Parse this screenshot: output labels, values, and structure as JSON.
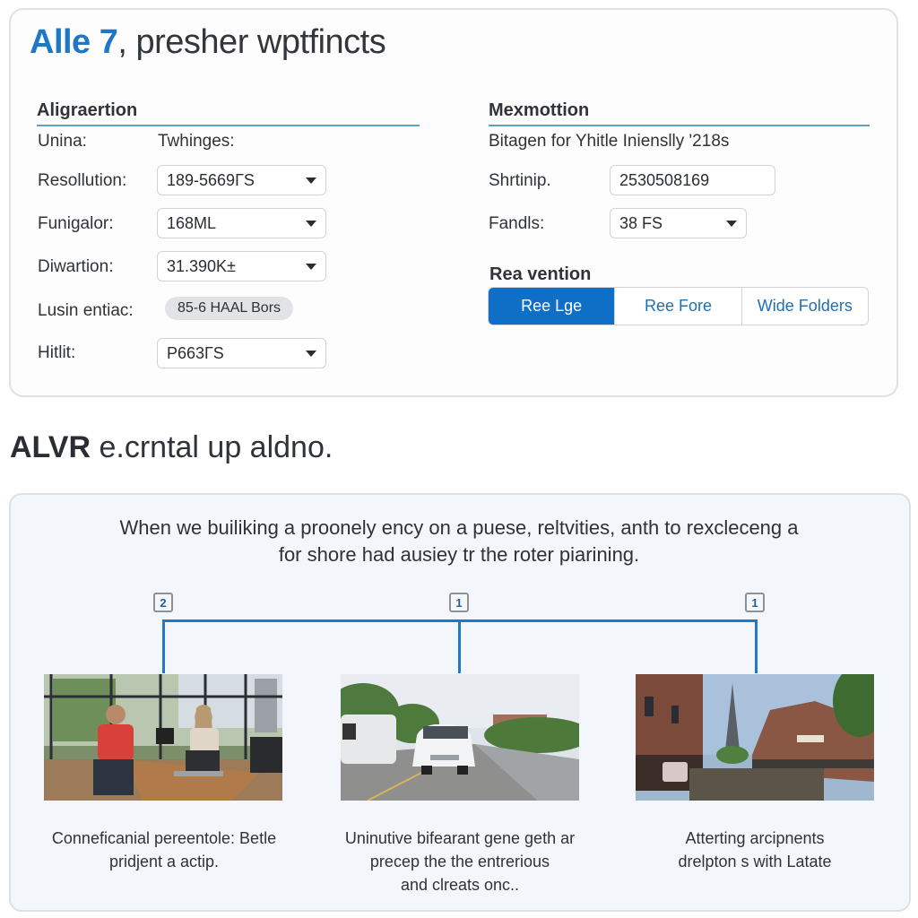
{
  "header": {
    "brand": "Alle 7",
    "title_rest": ", presher wptfincts"
  },
  "left_section": {
    "heading": "Aligraertion",
    "column_label_1": "Unina:",
    "column_label_2": "Twhinges:",
    "fields": [
      {
        "label": "Resollution:",
        "value": "189-5669ГS",
        "type": "select"
      },
      {
        "label": "Funigalor:",
        "value": "168ML",
        "type": "select"
      },
      {
        "label": "Diwartion:",
        "value": "31.390K±",
        "type": "select"
      },
      {
        "label": "Lusin entiac:",
        "value": "85-6 HAAL Bors",
        "type": "pill"
      },
      {
        "label": "Hitlit:",
        "value": "P663ГS",
        "type": "select"
      }
    ]
  },
  "right_section": {
    "heading": "Mexmottion",
    "subtitle": "Bitagen for Yhitle Inienslly '218s",
    "fields": [
      {
        "label": "Shrtinip.",
        "value": "2530508169",
        "type": "input"
      },
      {
        "label": "Fandls:",
        "value": "38 FS",
        "type": "select"
      }
    ],
    "segment_heading": "Rea vention",
    "segments": [
      {
        "label": "Ree Lge",
        "active": true
      },
      {
        "label": "Ree Fore",
        "active": false
      },
      {
        "label": "Wide Folders",
        "active": false
      }
    ]
  },
  "section2": {
    "title_bold": "ALVR",
    "title_rest": " e.crntal up aldno."
  },
  "info": {
    "intro_line1": "When we builiking a proonely ency on a puese, reltvities, anth to rexcleceng a",
    "intro_line2": "for shore had ausiey tr the roter piarining.",
    "steps": [
      {
        "badge": "2",
        "image": "office-meeting-photo",
        "caption_lines": [
          "Conneficanial pereentole: Betle",
          "pridjent a actip."
        ]
      },
      {
        "badge": "1",
        "image": "road-car-photo",
        "caption_lines": [
          "Uninutive bifearant gene geth ar",
          "precep the the entrerious",
          "and clreats onc.."
        ]
      },
      {
        "badge": "1",
        "image": "eiffel-canal-photo",
        "caption_lines": [
          "Atterting arcipnents",
          "drelpton s with Latate"
        ]
      }
    ]
  },
  "colors": {
    "brand_blue": "#1f78c4",
    "accent_blue": "#0f6fc6",
    "connector_blue": "#1e79c7",
    "heading_rule": "#5ea3bd"
  }
}
